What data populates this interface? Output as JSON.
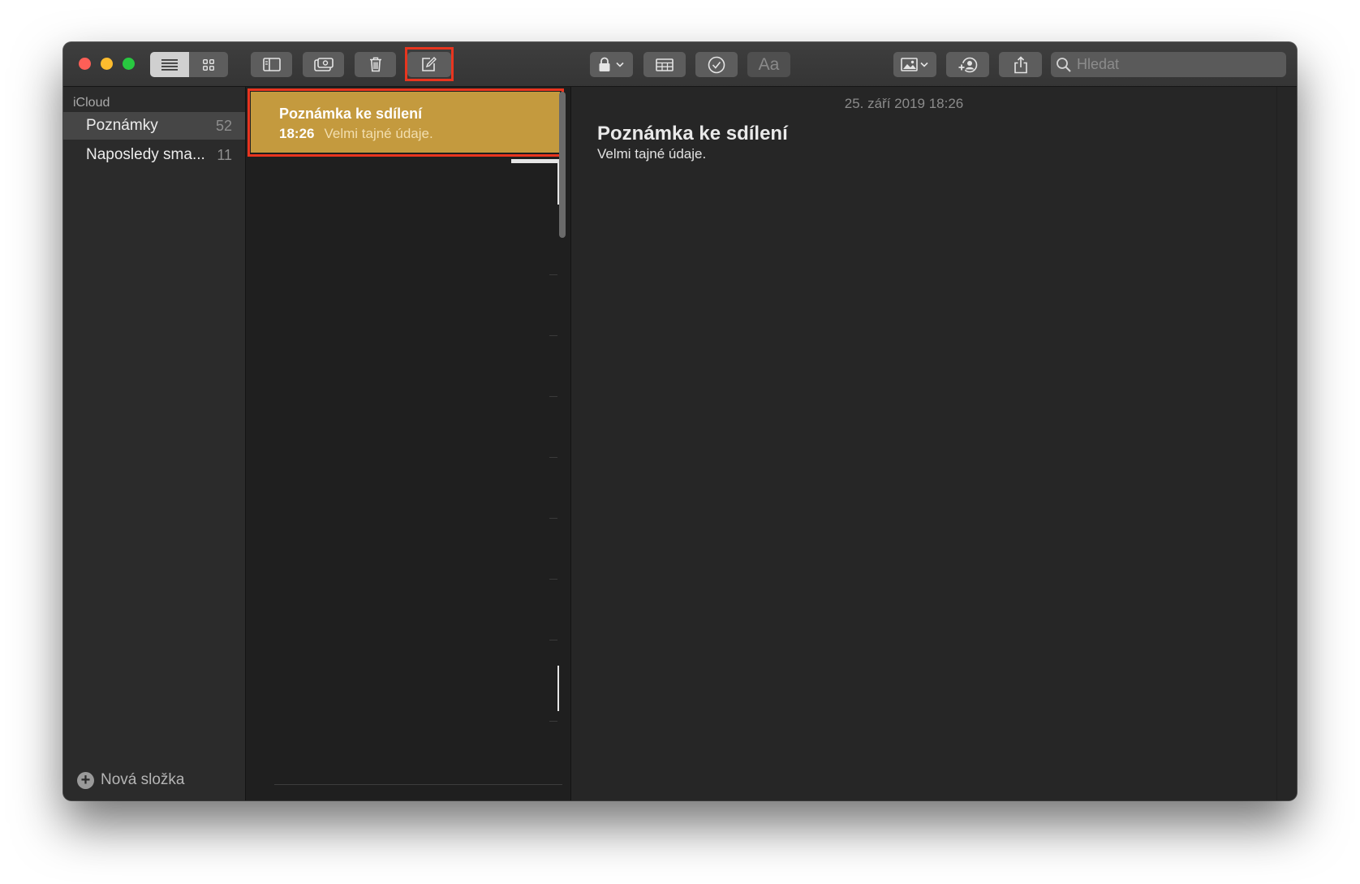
{
  "toolbar": {
    "view_list_icon": "list-view-icon",
    "view_gallery_icon": "gallery-view-icon",
    "sidebar_toggle_icon": "sidebar-icon",
    "attachments_icon": "attachments-icon",
    "delete_icon": "trash-icon",
    "compose_icon": "compose-icon",
    "lock_icon": "lock-icon",
    "table_icon": "table-icon",
    "checklist_icon": "checkmark-circle-icon",
    "format_label": "Aa",
    "media_icon": "photo-icon",
    "collaborate_icon": "add-people-icon",
    "share_icon": "share-icon",
    "search_placeholder": "Hledat",
    "highlight_color": "#e8351f"
  },
  "sidebar": {
    "section": "iCloud",
    "items": [
      {
        "label": "Poznámky",
        "count": "52",
        "selected": true
      },
      {
        "label": "Naposledy sma...",
        "count": "11",
        "selected": false
      }
    ],
    "new_folder_label": "Nová složka"
  },
  "notes_list": {
    "items": [
      {
        "title": "Poznámka ke sdílení",
        "time": "18:26",
        "snippet": "Velmi tajné údaje.",
        "selected": true
      }
    ],
    "selected_color": "#c49a3e"
  },
  "editor": {
    "date": "25. září 2019 18:26",
    "title": "Poznámka ke sdílení",
    "body": "Velmi tajné údaje."
  }
}
